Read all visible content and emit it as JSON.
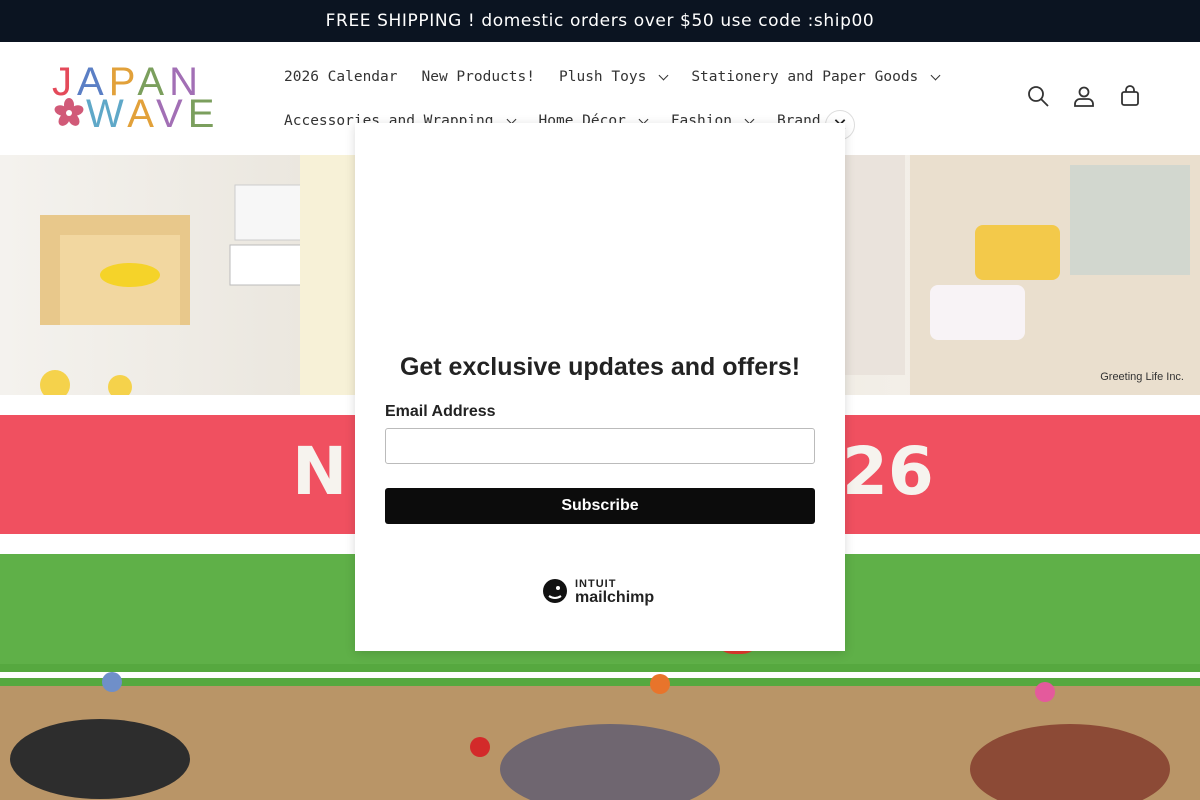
{
  "announcement": "FREE SHIPPING ! domestic orders over $50 use code :ship00",
  "logo": {
    "line1": "JAPAN",
    "line2": "WAVE"
  },
  "nav": {
    "row1": [
      {
        "label": "2026 Calendar",
        "dropdown": false
      },
      {
        "label": "New Products!",
        "dropdown": false
      },
      {
        "label": "Plush Toys",
        "dropdown": true
      },
      {
        "label": "Stationery and Paper Goods",
        "dropdown": true
      }
    ],
    "row2": [
      {
        "label": "Accessories and Wrapping",
        "dropdown": true
      },
      {
        "label": "Home Décor",
        "dropdown": true
      },
      {
        "label": "Fashion",
        "dropdown": true
      },
      {
        "label": "Brand",
        "dropdown": true
      }
    ]
  },
  "header_icons": [
    "search-icon",
    "account-icon",
    "cart-icon"
  ],
  "banner1": {
    "credit": "Greeting Life Inc."
  },
  "banner2": {
    "left_text": "N",
    "right_text": "26",
    "color": "#f05060"
  },
  "popup": {
    "title": "Get exclusive updates and offers!",
    "email_label": "Email Address",
    "email_value": "",
    "subscribe_label": "Subscribe",
    "brand_line1": "INTUIT",
    "brand_line2": "mailchimp",
    "close_symbol": "✕"
  }
}
